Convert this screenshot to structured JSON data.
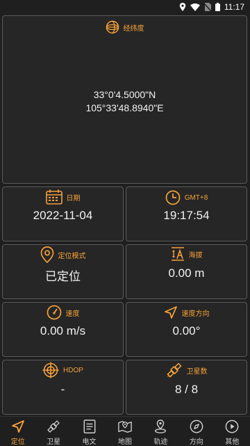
{
  "status_bar": {
    "time": "11:17"
  },
  "latlon": {
    "title": "经纬度",
    "latitude": "33°0'4.5000\"N",
    "longitude": "105°33'48.8940\"E"
  },
  "date": {
    "title": "日期",
    "value": "2022-11-04"
  },
  "time": {
    "title": "GMT+8",
    "value": "19:17:54"
  },
  "mode": {
    "title": "定位模式",
    "value": "已定位"
  },
  "altitude": {
    "title": "海拔",
    "value": "0.00 m"
  },
  "speed": {
    "title": "速度",
    "value": "0.00 m/s"
  },
  "heading": {
    "title": "速度方向",
    "value": "0.00°"
  },
  "hdop": {
    "title": "HDOP",
    "value": "-"
  },
  "satellites": {
    "title": "卫星数",
    "value": "8 / 8"
  },
  "nav": {
    "items": [
      {
        "label": "定位",
        "icon": "navigation-arrow-icon"
      },
      {
        "label": "卫星",
        "icon": "satellite-icon"
      },
      {
        "label": "电文",
        "icon": "document-icon"
      },
      {
        "label": "地图",
        "icon": "map-icon"
      },
      {
        "label": "轨迹",
        "icon": "track-pin-icon"
      },
      {
        "label": "方向",
        "icon": "compass-icon"
      },
      {
        "label": "其他",
        "icon": "play-circle-icon"
      }
    ],
    "active_index": 0
  },
  "colors": {
    "accent": "#f5a13a",
    "card_border": "#5a5a5a",
    "background": "#1f1f1f"
  }
}
